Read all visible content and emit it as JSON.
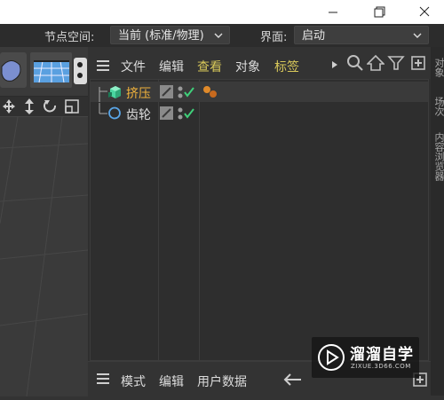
{
  "options_bar": {
    "node_space_label": "节点空间:",
    "node_space_value": "当前 (标准/物理)",
    "interface_label": "界面:",
    "interface_value": "启动"
  },
  "object_manager": {
    "menu": [
      "文件",
      "编辑",
      "查看",
      "对象",
      "标签"
    ],
    "active_menu_index": 2,
    "objects": [
      {
        "name": "挤压",
        "selected": true,
        "icon": "extrude-icon"
      },
      {
        "name": "齿轮",
        "selected": false,
        "icon": "gear-spline-icon"
      }
    ]
  },
  "attribute_bar": {
    "menu": [
      "模式",
      "编辑",
      "用户数据"
    ]
  },
  "right_tabs": [
    "对象",
    "场次",
    "内容浏览器"
  ],
  "watermark": {
    "title": "溜溜自学",
    "subtitle": "ZIXUE.3D66.COM"
  },
  "colors": {
    "selected_object": "#f0b23c",
    "active_menu": "#d8c85a",
    "check_mark": "#3fd07a"
  }
}
